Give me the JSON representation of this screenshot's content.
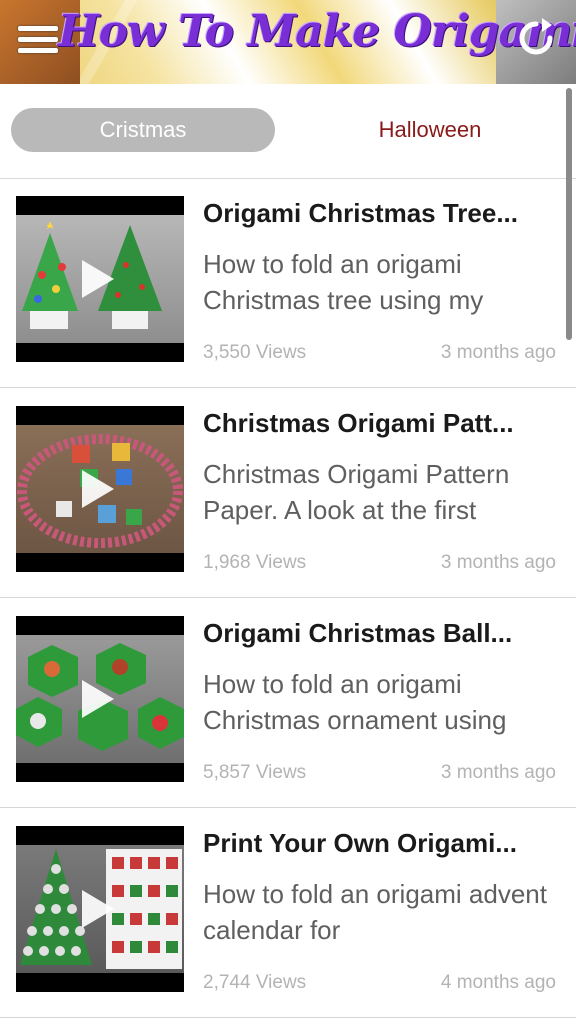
{
  "header": {
    "title": "How To Make Origami",
    "menu_icon": "hamburger-menu-icon",
    "refresh_icon": "refresh-icon"
  },
  "tabs": [
    {
      "label": "Cristmas",
      "active": true
    },
    {
      "label": "Halloween",
      "active": false
    }
  ],
  "videos": [
    {
      "title": "Origami Christmas Tree...",
      "description": "How to fold an origami Christmas tree using my",
      "views": "3,550 Views",
      "date": "3 months ago"
    },
    {
      "title": "Christmas Origami Patt...",
      "description": "Christmas Origami Pattern Paper. A look at the first",
      "views": "1,968 Views",
      "date": "3 months ago"
    },
    {
      "title": "Origami Christmas Ball...",
      "description": "How to fold an origami Christmas ornament using",
      "views": "5,857 Views",
      "date": "3 months ago"
    },
    {
      "title": "Print Your Own Origami...",
      "description": "How to fold an origami advent calendar for",
      "views": "2,744 Views",
      "date": "4 months ago"
    }
  ],
  "colors": {
    "title_purple": "#7a2fd6",
    "tab_active_bg": "#b9b9b9",
    "tab_inactive_text": "#8b1a1a"
  }
}
